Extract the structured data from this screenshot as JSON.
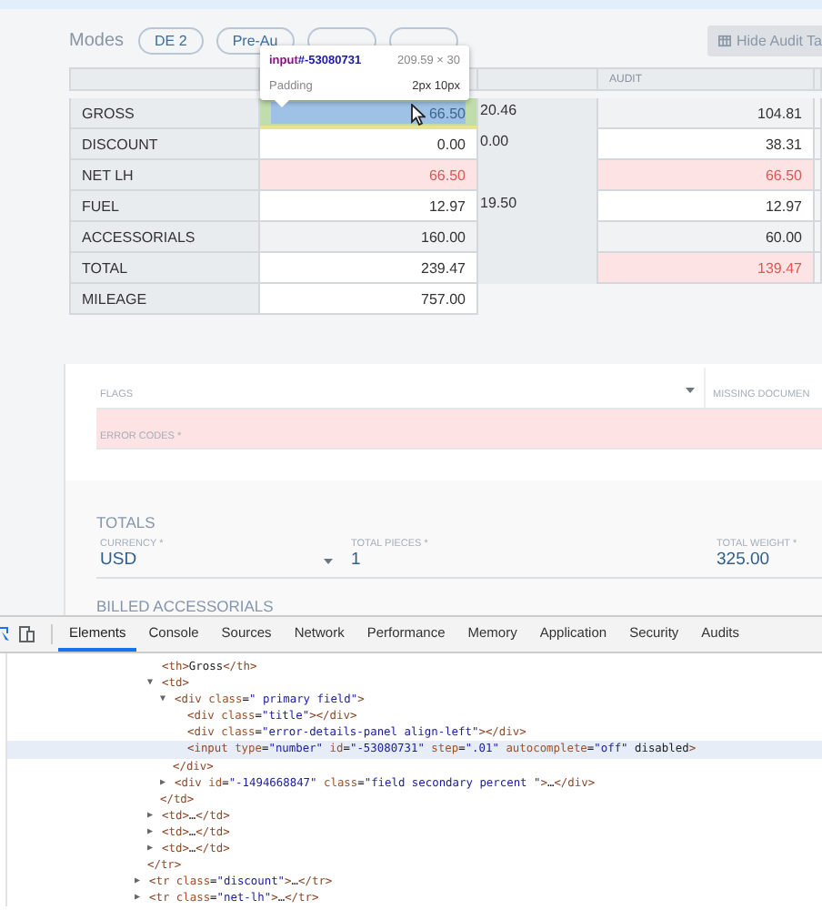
{
  "modes": {
    "label": "Modes",
    "pills": [
      {
        "kind": "labeled",
        "label": "DE 2"
      },
      {
        "kind": "labeled",
        "label": "Pre-Au"
      },
      {
        "kind": "covered"
      },
      {
        "kind": "covered"
      }
    ],
    "hide_button": {
      "label": "Hide Audit Ta"
    }
  },
  "inspector_tooltip": {
    "tag": "input",
    "id": "#-53080731",
    "size": "209.59 × 30",
    "property": "Padding",
    "value": "2px 10px"
  },
  "audit_table": {
    "audit_heading": "AUDIT",
    "rows": [
      {
        "label": "GROSS",
        "value": {
          "text": "66.50",
          "inspected": true,
          "error": false,
          "shaded": false
        },
        "secondary": "20.46",
        "audit": {
          "text": "104.81",
          "error": false,
          "shaded": true
        }
      },
      {
        "label": "DISCOUNT",
        "value": {
          "text": "0.00",
          "inspected": false,
          "error": false,
          "shaded": false
        },
        "secondary": "0.00",
        "audit": {
          "text": "38.31",
          "error": false,
          "shaded": false
        }
      },
      {
        "label": "NET LH",
        "value": {
          "text": "66.50",
          "inspected": false,
          "error": true,
          "shaded": false
        },
        "audit": {
          "text": "66.50",
          "error": true,
          "shaded": false
        }
      },
      {
        "label": "FUEL",
        "value": {
          "text": "12.97",
          "inspected": false,
          "error": false,
          "shaded": false
        },
        "secondary": "19.50",
        "audit": {
          "text": "12.97",
          "error": false,
          "shaded": false
        }
      },
      {
        "label": "ACCESSORIALS",
        "value": {
          "text": "160.00",
          "inspected": false,
          "error": false,
          "shaded": true
        },
        "audit": {
          "text": "60.00",
          "error": false,
          "shaded": true
        }
      },
      {
        "label": "TOTAL",
        "value": {
          "text": "239.47",
          "inspected": false,
          "error": false,
          "shaded": false
        },
        "audit": {
          "text": "139.47",
          "error": true,
          "shaded": false
        }
      },
      {
        "label": "MILEAGE",
        "value": {
          "text": "757.00",
          "inspected": false,
          "error": false,
          "shaded": false
        }
      }
    ]
  },
  "form": {
    "flags_label": "FLAGS",
    "missing_documents_label": "MISSING DOCUMEN",
    "error_codes": {
      "label": "ERROR CODES *",
      "invalid": true
    },
    "totals": {
      "heading": "TOTALS",
      "fields": [
        {
          "kind": "dropdown",
          "label": "CURRENCY *",
          "value": "USD"
        },
        {
          "kind": "text",
          "label": "TOTAL PIECES *",
          "value": "1"
        },
        {
          "kind": "text",
          "label": "TOTAL WEIGHT *",
          "value": "325.00"
        }
      ]
    },
    "billed_accessorials_heading": "BILLED ACCESSORIALS"
  },
  "devtools": {
    "tabs": [
      {
        "label": "Elements",
        "selected": true
      },
      {
        "label": "Console",
        "selected": false
      },
      {
        "label": "Sources",
        "selected": false
      },
      {
        "label": "Network",
        "selected": false
      },
      {
        "label": "Performance",
        "selected": false
      },
      {
        "label": "Memory",
        "selected": false
      },
      {
        "label": "Application",
        "selected": false
      },
      {
        "label": "Security",
        "selected": false
      },
      {
        "label": "Audits",
        "selected": false
      }
    ],
    "dom_tree": [
      {
        "children": [
          {
            "text": "<th>Gross</th>"
          },
          {
            "text": "<td>",
            "expander": "▼",
            "children": [
              {
                "text": "<div class=\"  primary  field\">",
                "expander": "▼",
                "children": [
                  {
                    "text": "<div class=\"title\"></div>"
                  },
                  {
                    "text": "<div class=\"error-details-panel align-left\"></div>"
                  },
                  {
                    "text": "<input type=\"number\" id=\"-53080731\" step=\".01\" autocomplete=\"off\" disabled>",
                    "selected": true
                  }
                ],
                "close": "</div>"
              },
              {
                "text": "<div id=\"-1494668847\" class=\"field  secondary percent  \">…</div>",
                "expander": "▶"
              }
            ],
            "close": "</td>"
          },
          {
            "text": "<td>…</td>",
            "expander": "▶"
          },
          {
            "text": "<td>…</td>",
            "expander": "▶"
          },
          {
            "text": "<td>…</td>",
            "expander": "▶"
          }
        ],
        "close": "</tr>"
      },
      {
        "text": "<tr class=\"discount\">…</tr>",
        "expander": "▶"
      },
      {
        "text": "<tr class=\"net-lh\">…</tr>",
        "expander": "▶"
      }
    ]
  }
}
